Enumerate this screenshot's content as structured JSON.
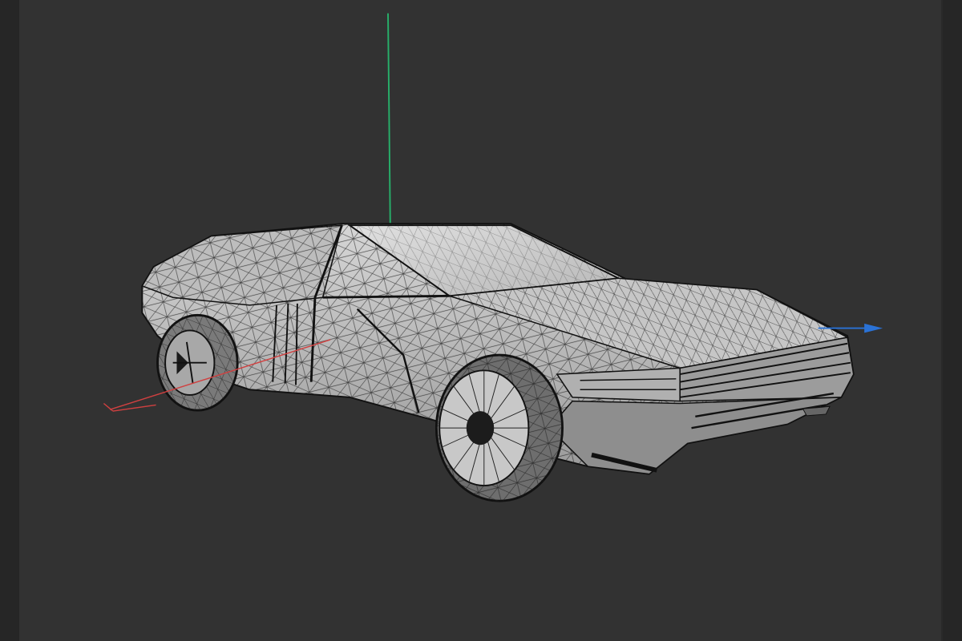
{
  "app": {
    "title": ""
  },
  "viewport": {
    "background": "#323232",
    "render_mode": "wireframe",
    "model": "sports-car",
    "axes": {
      "x_color": "#d04040",
      "y_color": "#27b06a",
      "z_color": "#2a72d6"
    }
  }
}
